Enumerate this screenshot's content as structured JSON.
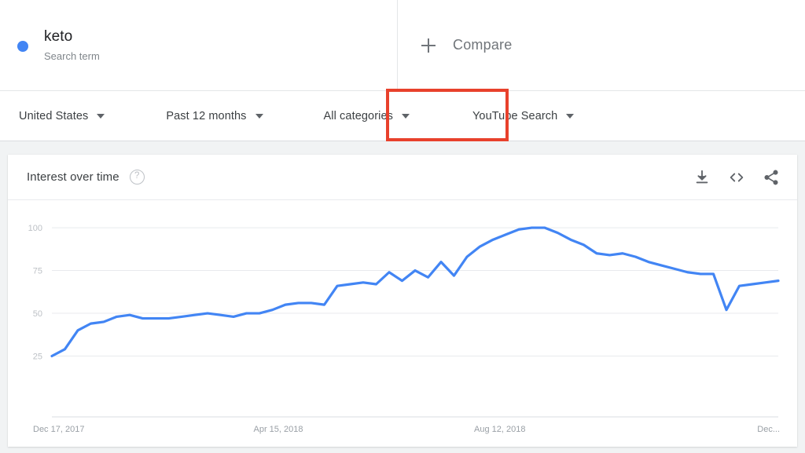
{
  "terms": [
    {
      "label": "keto",
      "type_label": "Search term",
      "color": "#4285f4"
    }
  ],
  "compare": {
    "label": "Compare",
    "icon": "plus-icon"
  },
  "filters": [
    {
      "name": "geo",
      "label": "United States"
    },
    {
      "name": "time",
      "label": "Past 12 months"
    },
    {
      "name": "category",
      "label": "All categories"
    },
    {
      "name": "property",
      "label": "YouTube Search",
      "highlight_color": "#e8412c"
    }
  ],
  "card": {
    "title": "Interest over time",
    "help_icon": "?",
    "actions": [
      {
        "name": "download-icon",
        "label": "Download"
      },
      {
        "name": "embed-icon",
        "label": "Embed"
      },
      {
        "name": "share-icon",
        "label": "Share"
      }
    ]
  },
  "chart_data": {
    "type": "line",
    "title": "Interest over time",
    "xlabel": "",
    "ylabel": "",
    "ylim": [
      0,
      106
    ],
    "yticks": [
      25,
      50,
      75,
      100
    ],
    "grid": true,
    "legend": false,
    "line_color": "#4285f4",
    "x_tick_labels": [
      "Dec 17, 2017",
      "Apr 15, 2018",
      "Aug 12, 2018",
      "Dec..."
    ],
    "x_tick_positions": [
      0,
      17,
      34,
      51
    ],
    "series": [
      {
        "name": "keto",
        "values": [
          25,
          29,
          40,
          44,
          45,
          48,
          49,
          47,
          47,
          47,
          48,
          49,
          50,
          49,
          48,
          50,
          50,
          52,
          55,
          56,
          56,
          55,
          66,
          67,
          68,
          67,
          74,
          69,
          75,
          71,
          80,
          72,
          83,
          89,
          93,
          96,
          99,
          100,
          100,
          97,
          93,
          90,
          85,
          84,
          85,
          83,
          80,
          78,
          76,
          74,
          73,
          73,
          52,
          66,
          67,
          68,
          69
        ]
      }
    ]
  }
}
